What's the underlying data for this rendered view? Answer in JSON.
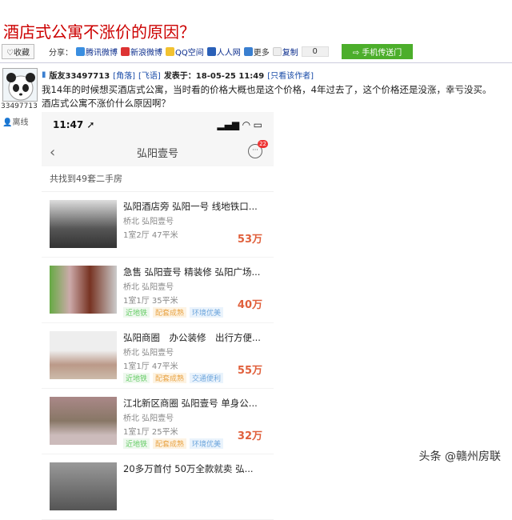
{
  "title": "酒店式公寓不涨价的原因？",
  "toolbar": {
    "favorite": "收藏",
    "share_label": "分享：",
    "shares": [
      "腾讯微博",
      "新浪微博",
      "QQ空间",
      "人人网",
      "更多"
    ],
    "copy": "复制",
    "count": "0",
    "mobile": "手机传送门"
  },
  "user": {
    "id": "33497713",
    "status": "离线"
  },
  "post": {
    "author": "版友33497713",
    "tag1": "[角落]",
    "tag2": "[飞语]",
    "posted": "发表于：18-05-25 11:49",
    "only_author": "[只看该作者]",
    "line1": "我14年的时候想买酒店式公寓，当时看的价格大概也是这个价格，4年过去了，这个价格还是没涨，幸亏没买。",
    "line2": "酒店式公寓不涨价什么原因啊？"
  },
  "phone": {
    "time": "11:47",
    "nav_title": "弘阳壹号",
    "badge": "22",
    "found": "共找到49套二手房",
    "items": [
      {
        "title": "弘阳酒店旁 弘阳一号 线地铁口...",
        "loc": "桥北 弘阳壹号",
        "spec": "1室2厅 47平米",
        "price": "53万",
        "tags": []
      },
      {
        "title": "急售 弘阳壹号 精装修 弘阳广场...",
        "loc": "桥北 弘阳壹号",
        "spec": "1室1厅 35平米",
        "price": "40万",
        "tags": [
          "近地铁",
          "配套成熟",
          "环境优美"
        ]
      },
      {
        "title": "弘阳商圈　办公装修　出行方便...",
        "loc": "桥北 弘阳壹号",
        "spec": "1室1厅 47平米",
        "price": "55万",
        "tags": [
          "近地铁",
          "配套成熟",
          "交通便利"
        ]
      },
      {
        "title": "江北新区商圈 弘阳壹号 单身公...",
        "loc": "桥北 弘阳壹号",
        "spec": "1室1厅 25平米",
        "price": "32万",
        "tags": [
          "近地铁",
          "配套成熟",
          "环境优美"
        ]
      },
      {
        "title": "20多万首付 50万全款就卖 弘...",
        "loc": "",
        "spec": "",
        "price": "",
        "tags": []
      }
    ]
  },
  "watermark": "头条 @赣州房联"
}
